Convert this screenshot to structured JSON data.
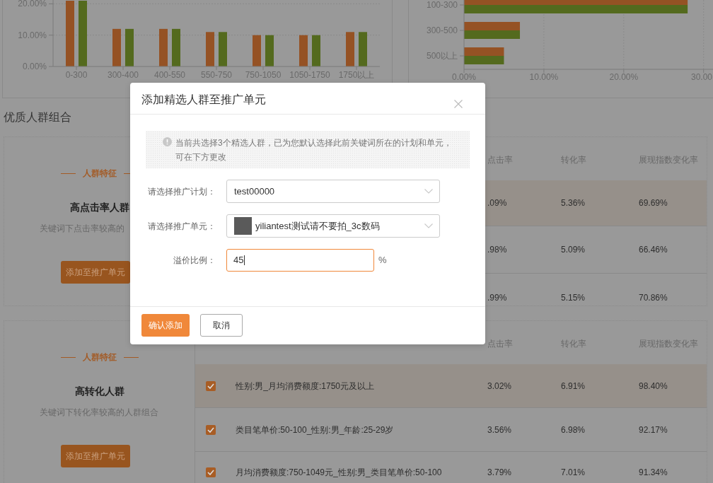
{
  "top_charts": [
    {
      "chart_data": {
        "type": "bar",
        "orientation": "vertical",
        "grid": true,
        "categories": [
          "0-300",
          "300-400",
          "400-550",
          "550-750",
          "750-1050",
          "1050-1750",
          "1750以上"
        ],
        "series": [
          {
            "color": "#955224",
            "values": [
              21,
              12,
              12,
              11,
              10,
              10,
              11
            ]
          },
          {
            "color": "#546a1e",
            "values": [
              21,
              12,
              12,
              11,
              10,
              10,
              11
            ]
          }
        ],
        "ylim": [
          0,
          21
        ],
        "yticks": [
          {
            "value": 0,
            "label": "0.00%"
          },
          {
            "value": 10,
            "label": "10.00%"
          },
          {
            "value": 20,
            "label": "20.00%"
          }
        ]
      }
    },
    {
      "chart_data": {
        "type": "bar",
        "orientation": "horizontal",
        "grid": true,
        "categories": [
          "100-300",
          "300-500",
          "500以上"
        ],
        "series": [
          {
            "color": "#955224",
            "values": [
              28,
              7,
              5
            ]
          },
          {
            "color": "#546a1e",
            "values": [
              28,
              7,
              5
            ]
          }
        ],
        "xlim": [
          0,
          31
        ],
        "xticks": [
          {
            "value": 0,
            "label": "0.00%"
          },
          {
            "value": 10,
            "label": "10.00%"
          },
          {
            "value": 20,
            "label": "20.00%"
          },
          {
            "value": 30,
            "label": "30.00"
          }
        ]
      }
    }
  ],
  "section_title": "优质人群组合",
  "groups": [
    {
      "feature_label": "人群特征",
      "title": "高点击率人群",
      "description": "关键词下点击率较高的",
      "button": "添加至推广单元",
      "columns": [
        "点击率",
        "转化率",
        "展现指数变化率"
      ],
      "rows": [
        {
          "highlighted": true,
          "values": [
            ".09%",
            "5.36%",
            "69.69%"
          ]
        },
        {
          "highlighted": false,
          "values": [
            ".98%",
            "5.09%",
            "66.46%"
          ]
        },
        {
          "highlighted": false,
          "values": [
            ".99%",
            "5.15%",
            "70.86%"
          ]
        }
      ]
    },
    {
      "feature_label": "人群特征",
      "title": "高转化人群",
      "description": "关键词下转化率较高的人群组合",
      "button": "添加至推广单元",
      "columns": [
        "点击率",
        "转化率",
        "展现指数变化率"
      ],
      "rows": [
        {
          "highlighted": true,
          "checked": true,
          "name": "性别:男_月均消费额度:1750元及以上",
          "values": [
            "3.02%",
            "6.91%",
            "98.40%"
          ]
        },
        {
          "highlighted": false,
          "checked": true,
          "name": "类目笔单价:50-100_性别:男_年龄:25-29岁",
          "values": [
            "3.56%",
            "6.98%",
            "92.17%"
          ]
        },
        {
          "highlighted": false,
          "checked": true,
          "name": "月均消费额度:750-1049元_性别:男_类目笔单价:50-100",
          "values": [
            "3.79%",
            "7.01%",
            "91.34%"
          ]
        }
      ]
    }
  ],
  "dialog": {
    "title": "添加精选人群至推广单元",
    "notice": "当前共选择3个精选人群，已为您默认选择此前关键词所在的计划和单元，可在下方更改",
    "fields": [
      {
        "kind": "select",
        "label": "请选择推广计划：",
        "value": "test00000"
      },
      {
        "kind": "select",
        "label": "请选择推广单元：",
        "value": "yiliantest测试请不要拍_3c数码",
        "thumbnail": true
      },
      {
        "kind": "input",
        "label": "溢价比例：",
        "value": "45",
        "unit": "%",
        "focused": true
      }
    ],
    "buttons": [
      {
        "kind": "primary",
        "label": "确认添加"
      },
      {
        "kind": "secondary",
        "label": "取消"
      }
    ]
  }
}
